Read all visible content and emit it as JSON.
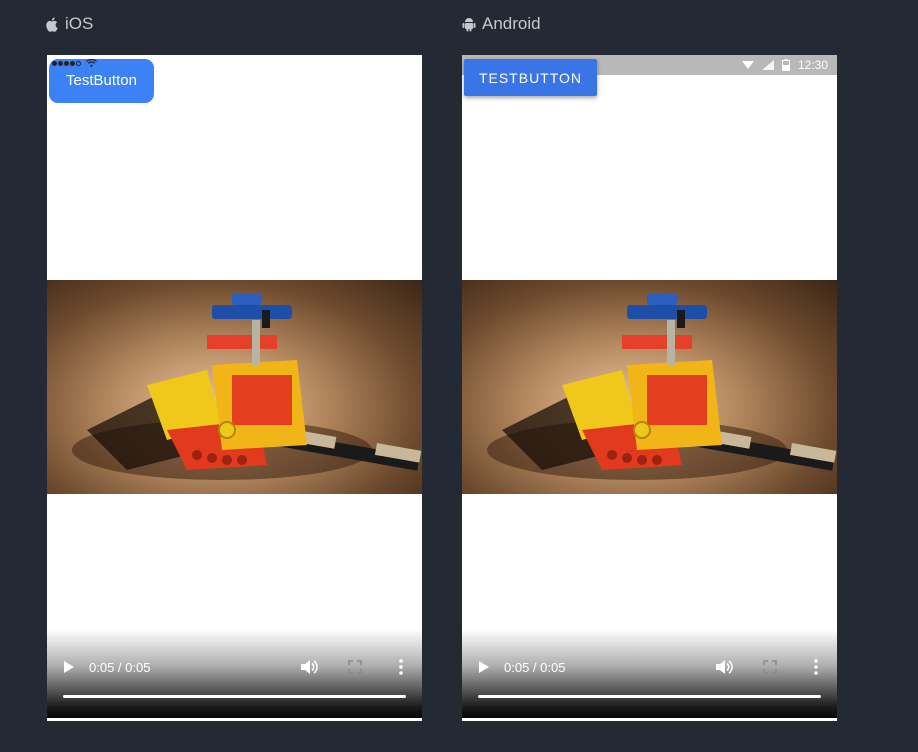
{
  "panels": {
    "ios": {
      "label": "iOS",
      "button_label": "TestButton",
      "video_time": "0:05 / 0:05"
    },
    "android": {
      "label": "Android",
      "button_label": "TestButton",
      "status_time": "12:30",
      "video_time": "0:05 / 0:05"
    }
  },
  "video": {
    "progress": 1.0,
    "subject": "lego technic helicopter"
  },
  "icons": [
    "apple-icon",
    "android-icon",
    "play-icon",
    "volume-icon",
    "fullscreen-icon",
    "more-icon",
    "wifi-icon",
    "signal-icon",
    "battery-icon"
  ],
  "colors": {
    "background": "#232a33",
    "ios_button": "#3c82f5",
    "android_button": "#3975e7"
  }
}
